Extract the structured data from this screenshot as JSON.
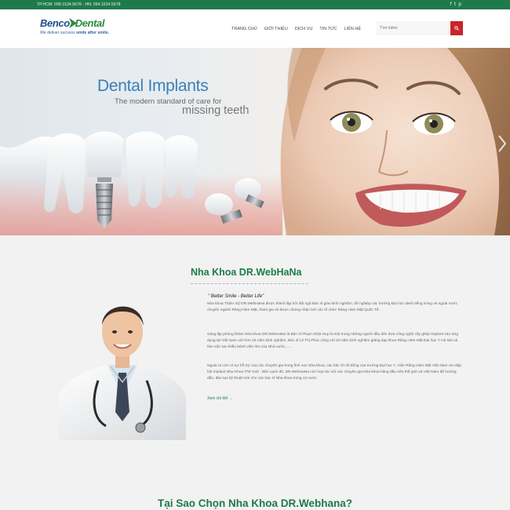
{
  "topbar": {
    "phones": "TP.HCM: 098.1534.5678 - HN: 094.1534.5678",
    "social": [
      "f",
      "t",
      "p"
    ]
  },
  "logo": {
    "brand_part1": "Benco",
    "brand_part2": "Dental",
    "tagline_part1": "We deliver success ",
    "tagline_part2": "smile after smile."
  },
  "nav": {
    "items": [
      "TRANG CHỦ",
      "GIỚI THIỆU",
      "DỊCH VỤ",
      "TIN TỨC",
      "LIÊN HỆ"
    ]
  },
  "search": {
    "placeholder": "Tìm kiếm"
  },
  "hero": {
    "title": "Dental Implants",
    "subtitle": "The modern standard of care for",
    "subtitle2": "missing teeth"
  },
  "about": {
    "title": "Nha Khoa DR.WebHaNa",
    "quote": "\" Better Smile - Better Life\"",
    "p1": "Nha khoa Thẩm mỹ DR.WebHaNa được thành lập bởi đội ngũ Bác sĩ giàu kinh nghiệm, tốt nghiệp các trường Đại học danh tiếng trong và ngoài nước chuyên ngành Răng Hàm Mặt, tham gia và được chứng nhận bởi các tổ chức Răng Hàm Mặt Quốc Tế.",
    "p2": "Sáng lập phòng khám Nha khoa DR.WebHaNa là Bác sĩ Phạm Nhật Huy là một trong những người đầu tiên đưa công nghệ cấy ghép Implant vào ứng dụng tại Việt Nam với hơn 20 năm kinh nghiệm, Bác sĩ Lê Thị Phúc cũng với 20 năm kinh nghiệm giảng dạy khoa Răng Hàm Mặt Đại học Y Hà Nội và làm việc tại nhiều bệnh viện lớn của Nhà nước, ....",
    "p3": "Ngoài ra còn có sự hỗ trợ của các chuyên gia trong lĩnh vực Nha khoa, các bác sĩ nổi tiếng của trường Đại học Y, Viện Răng Hàm Mặt Việt Nam và Hiệp hội Implant Nha Khoa Thế Giới . Bên cạnh đó, DR.WebHaNa còn hợp tác với các chuyên gia Nha khoa hàng đầu trên thế giới và Việt Nam để hướng dẫn, đào tạo kỹ thuật mới cho các bác sĩ Nha khoa trong cả nước.",
    "more": "Xem chi tiết →"
  },
  "why": {
    "title": "Tại Sao Chọn Nha Khoa DR.Webhana?"
  },
  "colors": {
    "brand_green": "#1e7a4a",
    "search_red": "#c8242b",
    "hero_blue": "#3b7fb8"
  }
}
